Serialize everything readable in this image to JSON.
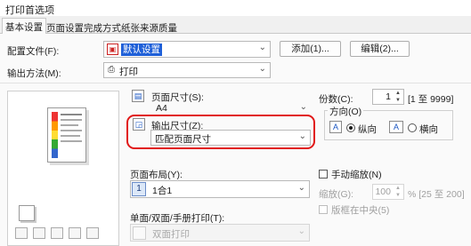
{
  "window": {
    "title": "打印首选项"
  },
  "tabs": [
    {
      "label": "基本设置",
      "active": true
    },
    {
      "label": "页面设置"
    },
    {
      "label": "完成方式"
    },
    {
      "label": "纸张来源"
    },
    {
      "label": "质量"
    }
  ],
  "profile": {
    "label": "配置文件(F):",
    "value": "默认设置",
    "add_button": "添加(1)...",
    "edit_button": "编辑(2)..."
  },
  "output_method": {
    "label": "输出方法(M):",
    "value": "打印"
  },
  "page_size": {
    "label": "页面尺寸(S):",
    "value": "A4"
  },
  "output_size": {
    "label": "输出尺寸(Z):",
    "value": "匹配页面尺寸"
  },
  "copies": {
    "label": "份数(C):",
    "value": "1",
    "range": "[1 至 9999]"
  },
  "orientation": {
    "label": "方向(O)",
    "portrait": "纵向",
    "landscape": "横向"
  },
  "layout": {
    "label": "页面布局(Y):",
    "value": "1合1",
    "icon_number": "1"
  },
  "manual_scaling": {
    "label": "手动缩放(N)",
    "scaling_label": "缩放(G):",
    "scaling_value": "100",
    "scaling_range": "% [25 至 200]",
    "center_label": "版框在中央(5)"
  },
  "duplex": {
    "label": "单面/双面/手册打印(T):",
    "value": "双面打印"
  },
  "colors": {
    "accent": "#e11818",
    "page_bg": "#fafafa"
  }
}
